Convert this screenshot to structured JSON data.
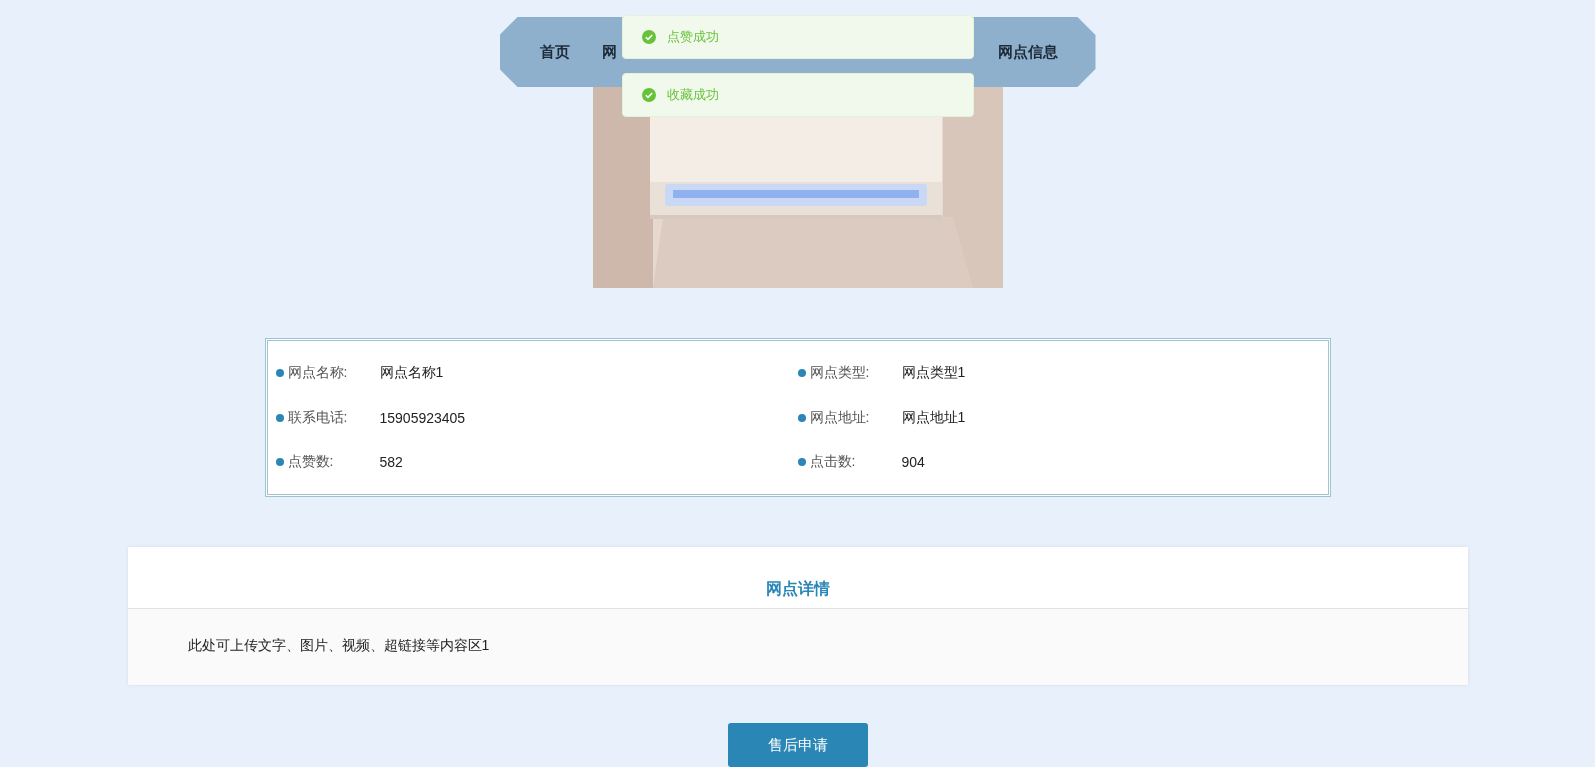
{
  "nav": {
    "items": [
      {
        "label": "首页"
      },
      {
        "label": "网"
      },
      {
        "label": "网点信息"
      }
    ]
  },
  "toasts": [
    {
      "kind": "success",
      "text": "点赞成功"
    },
    {
      "kind": "success",
      "text": "收藏成功"
    }
  ],
  "info": {
    "fields": [
      {
        "label": "网点名称:",
        "value": "网点名称1"
      },
      {
        "label": "网点类型:",
        "value": "网点类型1"
      },
      {
        "label": "联系电话:",
        "value": "15905923405"
      },
      {
        "label": "网点地址:",
        "value": "网点地址1"
      },
      {
        "label": "点赞数:",
        "value": "582"
      },
      {
        "label": "点击数:",
        "value": "904"
      }
    ]
  },
  "details": {
    "title": "网点详情",
    "content": "此处可上传文字、图片、视频、超链接等内容区1"
  },
  "action_button": "售后申请"
}
